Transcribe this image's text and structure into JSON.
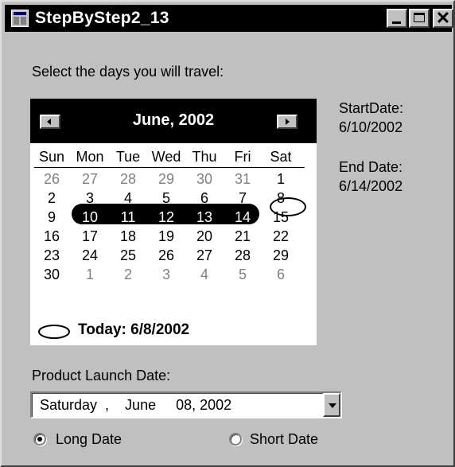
{
  "window": {
    "title": "StepByStep2_13",
    "controls": {
      "minimize": "_",
      "maximize": "□",
      "close": "✕"
    }
  },
  "instructions": "Select the days you will travel:",
  "calendar": {
    "month_title": "June, 2002",
    "day_names": [
      "Sun",
      "Mon",
      "Tue",
      "Wed",
      "Thu",
      "Fri",
      "Sat"
    ],
    "weeks": [
      [
        "26",
        "27",
        "28",
        "29",
        "30",
        "31",
        "1"
      ],
      [
        "2",
        "3",
        "4",
        "5",
        "6",
        "7",
        "8"
      ],
      [
        "9",
        "10",
        "11",
        "12",
        "13",
        "14",
        "15"
      ],
      [
        "16",
        "17",
        "18",
        "19",
        "20",
        "21",
        "22"
      ],
      [
        "23",
        "24",
        "25",
        "26",
        "27",
        "28",
        "29"
      ],
      [
        "30",
        "1",
        "2",
        "3",
        "4",
        "5",
        "6"
      ]
    ],
    "selected_range": [
      "10",
      "11",
      "12",
      "13",
      "14"
    ],
    "today_day": "8",
    "today_text": "Today: 6/8/2002",
    "prev_icon": "left-arrow-icon",
    "next_icon": "right-arrow-icon"
  },
  "start_date": {
    "label": "StartDate:",
    "value": "6/10/2002"
  },
  "end_date": {
    "label": "End Date:",
    "value": "6/14/2002"
  },
  "launch": {
    "label": "Product Launch Date:",
    "value": "  Saturday  ,    June     08, 2002"
  },
  "format_options": {
    "long": {
      "label": "Long Date",
      "checked": true
    },
    "short": {
      "label": "Short Date",
      "checked": false
    }
  }
}
